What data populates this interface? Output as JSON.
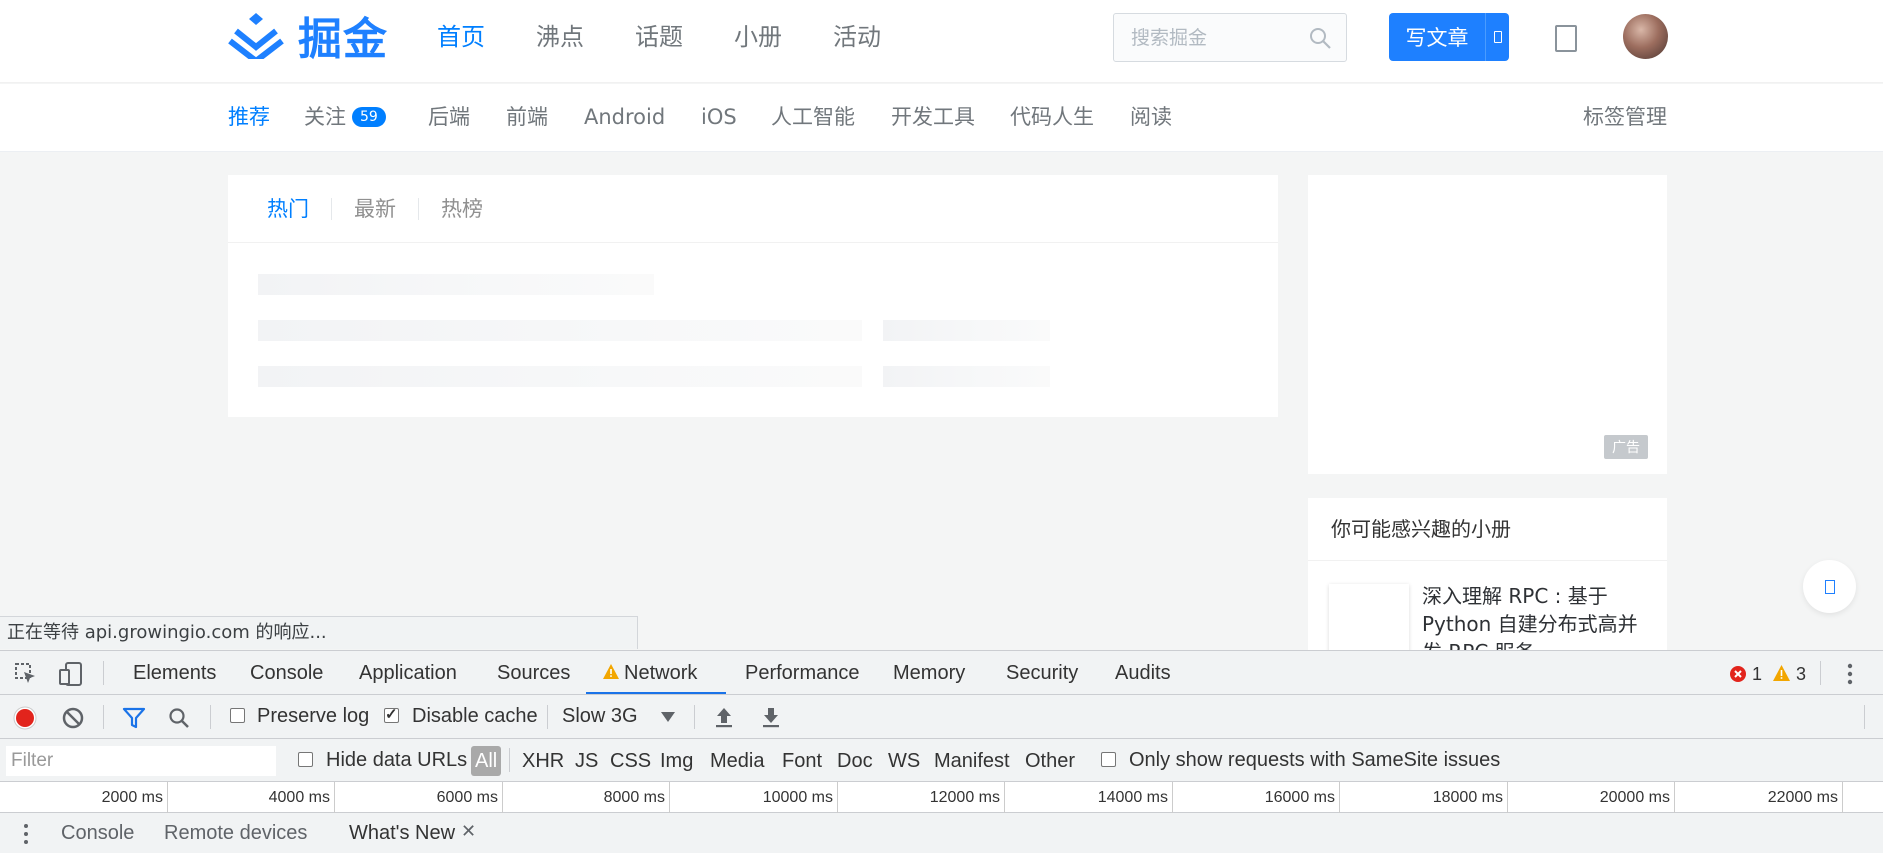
{
  "header": {
    "logo_text": "掘金",
    "nav": [
      "首页",
      "沸点",
      "话题",
      "小册",
      "活动"
    ],
    "search_placeholder": "搜索掘金",
    "write_label": "写文章"
  },
  "subnav": {
    "tags": [
      "推荐",
      "关注",
      "后端",
      "前端",
      "Android",
      "iOS",
      "人工智能",
      "开发工具",
      "代码人生",
      "阅读"
    ],
    "follow_badge": "59",
    "manage_label": "标签管理"
  },
  "feed": {
    "tabs": [
      "热门",
      "最新",
      "热榜"
    ]
  },
  "sidebar": {
    "ad_label": "广告",
    "books_title": "你可能感兴趣的小册",
    "book_title": "深入理解 RPC : 基于 Python 自建分布式高并发 RPC 服务"
  },
  "status_text": "正在等待 api.growingio.com 的响应...",
  "devtools": {
    "tabs": [
      "Elements",
      "Console",
      "Application",
      "Sources",
      "Network",
      "Performance",
      "Memory",
      "Security",
      "Audits"
    ],
    "active_tab": "Network",
    "error_count": "1",
    "warning_count": "3",
    "toolbar": {
      "preserve_log": "Preserve log",
      "disable_cache": "Disable cache",
      "throttle": "Slow 3G"
    },
    "filter": {
      "placeholder": "Filter",
      "hide_data_urls": "Hide data URLs",
      "types": [
        "All",
        "XHR",
        "JS",
        "CSS",
        "Img",
        "Media",
        "Font",
        "Doc",
        "WS",
        "Manifest",
        "Other"
      ],
      "samesite": "Only show requests with SameSite issues"
    },
    "timeline_ticks": [
      "2000 ms",
      "4000 ms",
      "6000 ms",
      "8000 ms",
      "10000 ms",
      "12000 ms",
      "14000 ms",
      "16000 ms",
      "18000 ms",
      "20000 ms",
      "22000 ms"
    ],
    "drawer_tabs": [
      "Console",
      "Remote devices",
      "What's New"
    ]
  },
  "colors": {
    "brand": "#1e80ff",
    "link": "#007fff",
    "record": "#e2241c"
  }
}
